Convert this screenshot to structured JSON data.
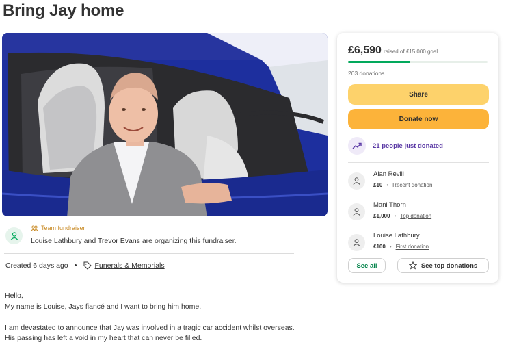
{
  "page": {
    "title": "Bring Jay home"
  },
  "organizer": {
    "tag": "Team fundraiser",
    "text": "Louise Lathbury and Trevor Evans are organizing this fundraiser."
  },
  "meta": {
    "created": "Created 6 days ago",
    "separator": "•",
    "category": "Funerals & Memorials"
  },
  "story": {
    "lines": [
      "Hello,",
      "My name is Louise, Jays fiancé and I want to bring him home.",
      "",
      "I am devastated to announce that Jay was involved in a tragic car accident whilst overseas.",
      "His passing has left a void in my heart that can never be filled."
    ]
  },
  "donation_card": {
    "amount_raised": "£6,590",
    "goal_text": "raised of £15,000 goal",
    "progress_fraction": 0.44,
    "donations_count": "203 donations",
    "share_label": "Share",
    "donate_label": "Donate now",
    "just_donated": "21 people just donated",
    "separator": "•",
    "donors": [
      {
        "name": "Alan Revill",
        "amount": "£10",
        "kind": "Recent donation"
      },
      {
        "name": "Mani Thorn",
        "amount": "£1,000",
        "kind": "Top donation"
      },
      {
        "name": "Louise Lathbury",
        "amount": "£100",
        "kind": "First donation"
      }
    ],
    "see_all_label": "See all",
    "see_top_label": "See top donations"
  },
  "colors": {
    "brand_green": "#02a95c",
    "share_yellow": "#fdd26b",
    "donate_orange": "#fcb33a",
    "purple": "#5b3aa5",
    "car_blue": "#1d2f9e"
  },
  "icons": [
    "person-icon",
    "team-icon",
    "tag-icon",
    "trend-up-icon",
    "star-icon"
  ]
}
